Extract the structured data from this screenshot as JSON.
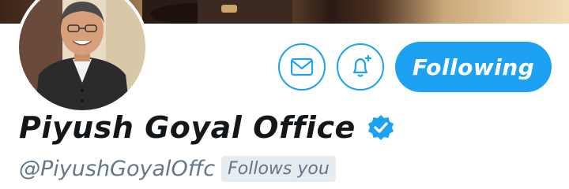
{
  "profile": {
    "display_name": "Piyush Goyal Office",
    "handle": "@PiyushGoyalOffc",
    "follows_you_badge": "Follows you",
    "verified": true
  },
  "actions": {
    "message_icon": "envelope-icon",
    "notifications_icon": "bell-plus-icon",
    "follow_label": "Following"
  },
  "colors": {
    "accent": "#1da1f2",
    "text_primary": "#14171a",
    "text_secondary": "#657786",
    "badge_bg": "#e6ecf0"
  }
}
